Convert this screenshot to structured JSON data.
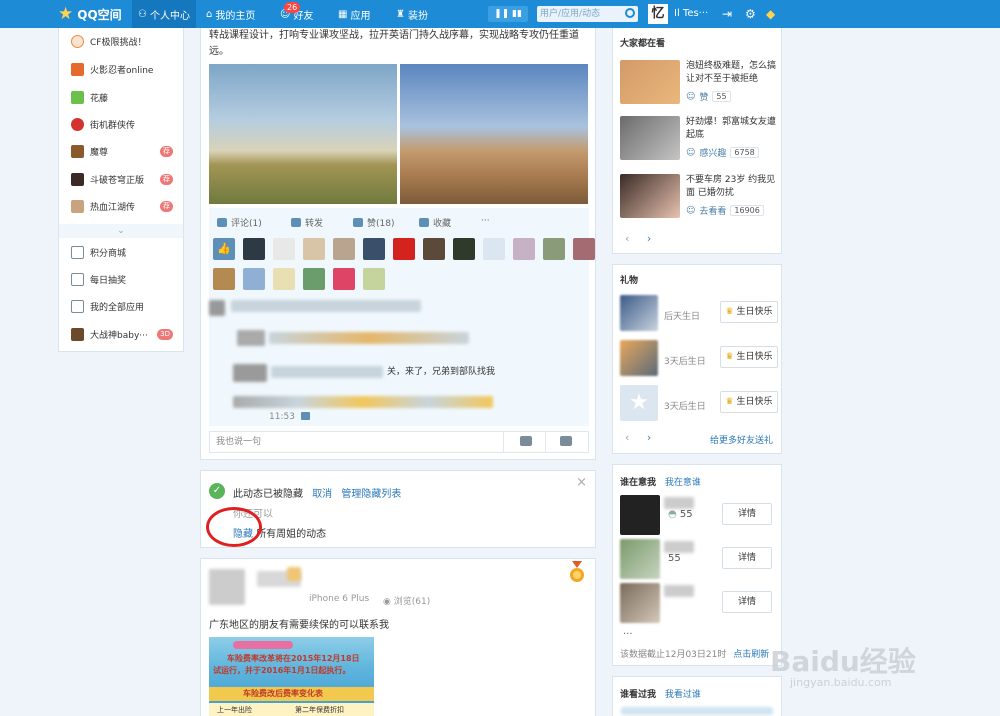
{
  "topbar": {
    "brand": "QQ空间",
    "nav": {
      "personal_center": "个人中心",
      "my_home": "我的主页",
      "friends": "好友",
      "friends_badge": "26",
      "apps": "应用",
      "decorate": "装扮"
    },
    "search_placeholder": "用户/应用/动态",
    "avatar_char": "忆",
    "username": "Il Tes···"
  },
  "left_panel": {
    "items": [
      {
        "label": "CF极限挑战！",
        "tag": ""
      },
      {
        "label": "火影忍者online",
        "tag": ""
      },
      {
        "label": "花藤",
        "tag": ""
      },
      {
        "label": "街机群侠传",
        "tag": ""
      },
      {
        "label": "魔尊",
        "tag": "荐"
      },
      {
        "label": "斗破苍穹正版",
        "tag": "荐"
      },
      {
        "label": "热血江湖传",
        "tag": "荐"
      }
    ],
    "chevron": "⌄",
    "more_items": [
      {
        "label": "积分商城",
        "tag": ""
      },
      {
        "label": "每日抽奖",
        "tag": ""
      },
      {
        "label": "我的全部应用",
        "tag": ""
      },
      {
        "label": "大战神baby···",
        "tag": "3D"
      }
    ]
  },
  "feed": {
    "post_text": "转战课程设计，打响专业课攻坚战，拉开英语门持久战序幕，实现战略专攻仍任重道远。",
    "actions": {
      "comment": "评论(1)",
      "share": "转发",
      "like": "赞(18)",
      "favorite": "收藏",
      "more": "···"
    },
    "comments": [
      {
        "text": "",
        "time": ""
      },
      {
        "text": "",
        "time": ""
      },
      {
        "text": "关，来了，兄弟到部队找我",
        "time": ""
      },
      {
        "text": "",
        "time": "11:53"
      }
    ],
    "reply_placeholder": "我也说一句"
  },
  "hidden_notice": {
    "message": "此动态已被隐藏",
    "undo": "取消",
    "manage": "管理隐藏列表",
    "hint": "你还可以",
    "hide_link": "隐藏",
    "hide_suffix": "所有周姐的动态",
    "close": "×"
  },
  "post2": {
    "device": "iPhone 6 Plus",
    "views": "浏览(61)",
    "text": "广东地区的朋友有需要续保的可以联系我",
    "image_lines": [
      "车险费率改革将在2015年12月18日",
      "试运行，并于2016年1月1日起执行。",
      "车险费改后费率变化表",
      "上一年出险",
      "第二年保费折扣"
    ]
  },
  "right": {
    "trending": {
      "title": "大家都在看",
      "items": [
        {
          "text": "泡妞终极难题，怎么搞让对不至于被拒绝",
          "meta": "赞",
          "count": "55"
        },
        {
          "text": "好劲爆！郭富城女友遭起底",
          "meta": "感兴趣",
          "count": "6758"
        },
        {
          "text": "不要车房 23岁 约我见面 已婚勿扰",
          "meta": "去看看",
          "count": "16906"
        }
      ]
    },
    "gifts": {
      "title": "礼物",
      "items": [
        {
          "when": "后天生日",
          "button": "生日快乐"
        },
        {
          "when": "3天后生日",
          "button": "生日快乐"
        },
        {
          "when": "3天后生日",
          "button": "生日快乐"
        }
      ],
      "more_link": "给更多好友送礼"
    },
    "who_cares": {
      "tab_active": "谁在意我",
      "tab_other": "我在意谁",
      "items": [
        {
          "num": "55",
          "button": "详情"
        },
        {
          "num": "55",
          "button": "详情"
        },
        {
          "num": "",
          "button": "详情"
        }
      ],
      "more": "···",
      "footer": "该数据截止12月03日21时",
      "refresh": "点击刷新"
    },
    "visitors": {
      "tab_active": "谁看过我",
      "tab_other": "我看过谁"
    }
  },
  "watermark": {
    "main": "Baidu经验",
    "sub": "jingyan.baidu.com"
  }
}
